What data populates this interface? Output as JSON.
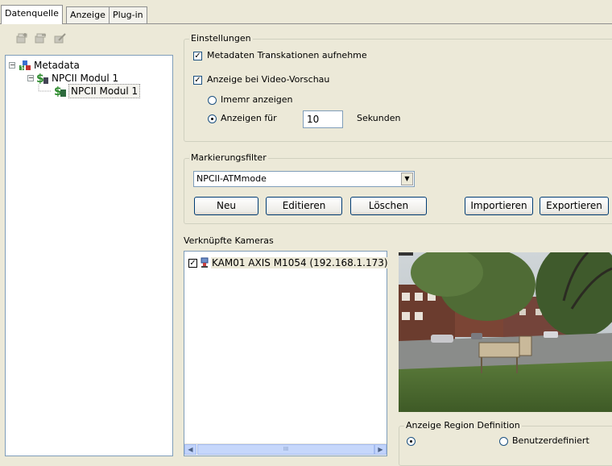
{
  "tabs": [
    {
      "label": "Datenquelle",
      "active": true
    },
    {
      "label": "Anzeige",
      "active": false
    },
    {
      "label": "Plug-in",
      "active": false
    }
  ],
  "toolbar": {
    "icons": [
      "add-icon",
      "remove-icon",
      "edit-icon"
    ]
  },
  "tree": {
    "root": {
      "label": "Metadata",
      "expanded": true,
      "icon": "metadata-icon"
    },
    "child": {
      "label": "NPCII Modul 1",
      "expanded": true,
      "icon": "module-icon"
    },
    "leaf": {
      "label": "NPCII Modul 1",
      "selected": true,
      "icon": "module-leaf-icon"
    }
  },
  "einstellungen": {
    "title": "Einstellungen",
    "checkbox_transactions": {
      "label": "Metadaten Transkationen aufnehme",
      "checked": true
    },
    "checkbox_preview": {
      "label": "Anzeige bei Video-Vorschau",
      "checked": true
    },
    "radio_always": {
      "label": "Imemr anzeigen",
      "selected": false
    },
    "radio_for": {
      "label": "Anzeigen für",
      "selected": true
    },
    "seconds_value": "10",
    "seconds_unit": "Sekunden"
  },
  "markierungsfilter": {
    "title": "Markierungsfilter",
    "selected": "NPCII-ATMmode",
    "buttons": {
      "neu": "Neu",
      "editieren": "Editieren",
      "loeschen": "Löschen",
      "importieren": "Importieren",
      "exportieren": "Exportieren"
    }
  },
  "cameras": {
    "title": "Verknüpfte Kameras",
    "items": [
      {
        "label": "KAM01 AXIS M1054 (192.168.1.173)",
        "checked": true,
        "icon": "camera-icon"
      }
    ],
    "scroll": {
      "thumb_grip": "III"
    }
  },
  "region": {
    "title": "Anzeige Region Definition",
    "radio_default": {
      "label": "",
      "selected": true
    },
    "radio_custom": {
      "label": "Benutzerdefiniert",
      "selected": false
    }
  },
  "colors": {
    "background": "#ece9d8",
    "border_blue": "#7f9db9",
    "button_border": "#003c74"
  }
}
